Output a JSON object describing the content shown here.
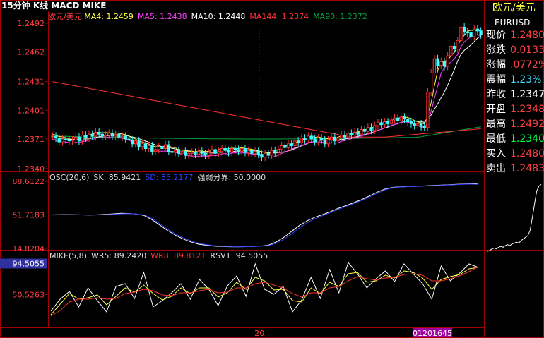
{
  "window_title": "15分钟 K线 MACD MIKE",
  "instrument": {
    "name": "欧元/美元",
    "code": "EURUSD"
  },
  "quote": [
    {
      "label": "现价",
      "value": "1.2480",
      "color": "#ff4040"
    },
    {
      "label": "涨跌",
      "value": "0.0133",
      "color": "#ff4040"
    },
    {
      "label": "涨幅",
      "value": ".0772%",
      "color": "#ff4040"
    },
    {
      "label": "震幅",
      "value": "1.23%",
      "color": "#40e0ff"
    },
    {
      "label": "昨收",
      "value": "1.2347",
      "color": "#ffffff"
    },
    {
      "label": "开盘",
      "value": "1.2348",
      "color": "#ff4040"
    },
    {
      "label": "最高",
      "value": "1.2492",
      "color": "#ff4040"
    },
    {
      "label": "最低",
      "value": "1.2340",
      "color": "#00ff40"
    },
    {
      "label": "买入",
      "value": "1.2480",
      "color": "#ff4040"
    },
    {
      "label": "卖出",
      "value": "1.2483",
      "color": "#ff4040"
    }
  ],
  "colors": {
    "bg": "#000000",
    "frame": "#a00000",
    "up": "#ff3030",
    "down": "#40ffff",
    "yellow": "#ffff40",
    "white": "#ffffff",
    "magenta": "#ff40ff",
    "red": "#ff3030",
    "green": "#00a040",
    "blue": "#3040ff",
    "axis_text": "#ff4040"
  },
  "chart_data": [
    {
      "type": "candlestick",
      "legend": {
        "symbol": "欧元/美元",
        "items": [
          {
            "name": "MA4",
            "value": "1.2459",
            "color": "#ffff40"
          },
          {
            "name": "MA5",
            "value": "1.2438",
            "color": "#ff40ff"
          },
          {
            "name": "MA10",
            "value": "1.2448",
            "color": "#ffffff"
          },
          {
            "name": "MA144",
            "value": "1.2374",
            "color": "#ff3030"
          },
          {
            "name": "MA90",
            "value": "1.2372",
            "color": "#00a040"
          }
        ]
      },
      "yticks": [
        "1.2492",
        "1.2462",
        "1.2431",
        "1.2401",
        "1.2371",
        "1.2340"
      ],
      "ylim": [
        1.234,
        1.2492
      ],
      "xticks": [
        "20"
      ],
      "ohlc_close": [
        1.2374,
        1.2372,
        1.2368,
        1.2371,
        1.237,
        1.2369,
        1.237,
        1.2373,
        1.2369,
        1.2375,
        1.2372,
        1.2376,
        1.2374,
        1.2378,
        1.2376,
        1.2374,
        1.2375,
        1.2377,
        1.2374,
        1.2376,
        1.2373,
        1.2374,
        1.2371,
        1.237,
        1.2366,
        1.2369,
        1.2363,
        1.2366,
        1.2361,
        1.2364,
        1.2358,
        1.236,
        1.2363,
        1.2361,
        1.2365,
        1.2358,
        1.2357,
        1.2359,
        1.2356,
        1.2358,
        1.2354,
        1.2356,
        1.2357,
        1.2355,
        1.2358,
        1.2356,
        1.2354,
        1.2357,
        1.236,
        1.2356,
        1.2358,
        1.2361,
        1.2359,
        1.2357,
        1.2361,
        1.236,
        1.2358,
        1.2361,
        1.2357,
        1.2359,
        1.2356,
        1.2358,
        1.2355,
        1.2352,
        1.2356,
        1.2354,
        1.2359,
        1.2357,
        1.236,
        1.2364,
        1.2362,
        1.2366,
        1.2364,
        1.2369,
        1.2367,
        1.2372,
        1.237,
        1.2374,
        1.2371,
        1.2368,
        1.2372,
        1.237,
        1.2366,
        1.237,
        1.2373,
        1.2369,
        1.2372,
        1.2375,
        1.2373,
        1.2377,
        1.2375,
        1.2378,
        1.2376,
        1.2381,
        1.2379,
        1.2383,
        1.238,
        1.2385,
        1.2388,
        1.2386,
        1.2389,
        1.2387,
        1.2391,
        1.2393,
        1.239,
        1.2394,
        1.2392,
        1.2389,
        1.2387,
        1.2385,
        1.2387,
        1.2384,
        1.2383,
        1.242,
        1.244,
        1.2455,
        1.2448,
        1.2452,
        1.2447,
        1.2458,
        1.2468,
        1.2465,
        1.2474,
        1.2488,
        1.2483,
        1.2482,
        1.2478,
        1.2486,
        1.2484,
        1.248
      ]
    },
    {
      "type": "line",
      "legend": {
        "items": [
          {
            "name": "OSC(20,6)",
            "value": "",
            "color": "#dddddd"
          },
          {
            "name": "SK",
            "value": "85.9421",
            "color": "#dddddd"
          },
          {
            "name": "SD",
            "value": "85.2177",
            "color": "#3040ff"
          },
          {
            "name": "强弱分界",
            "value": "50.0000",
            "color": "#dddddd"
          }
        ]
      },
      "yticks": [
        "88.6122",
        "51.7183",
        "14.8204"
      ],
      "ylim": [
        14.8204,
        88.6122
      ],
      "divider": 51.7183,
      "series": [
        {
          "name": "SK",
          "values": [
            51.7,
            51.9,
            52.0,
            51.9,
            51.7,
            51.5,
            51.8,
            52.3,
            52.8,
            53.4,
            53.3,
            52.6,
            51.0,
            46.4,
            40.5,
            34.6,
            29.5,
            25.2,
            22.0,
            19.5,
            18.3,
            17.4,
            16.9,
            16.7,
            16.6,
            16.8,
            17.0,
            17.4,
            18.4,
            21.9,
            27.2,
            33.7,
            40.2,
            45.3,
            49.2,
            52.1,
            55.4,
            59.0,
            62.0,
            65.2,
            68.6,
            72.6,
            76.7,
            80.2,
            82.0,
            82.6,
            82.9,
            83.1,
            83.6,
            84.0,
            84.4,
            84.7,
            85.2,
            85.6,
            85.9,
            86.2
          ]
        },
        {
          "name": "SD",
          "values": [
            51.5,
            51.7,
            51.8,
            51.8,
            51.7,
            51.6,
            51.6,
            51.9,
            52.3,
            52.8,
            53.0,
            52.7,
            51.6,
            47.8,
            42.1,
            36.0,
            30.9,
            26.6,
            23.2,
            20.6,
            19.0,
            17.9,
            17.2,
            16.9,
            16.7,
            16.7,
            16.9,
            17.2,
            17.9,
            20.3,
            24.9,
            31.0,
            37.5,
            43.1,
            47.6,
            51.0,
            54.3,
            57.9,
            61.0,
            64.2,
            67.6,
            71.4,
            75.6,
            79.3,
            81.6,
            82.4,
            82.8,
            83.0,
            83.4,
            83.8,
            84.2,
            84.5,
            84.9,
            85.3,
            85.6,
            85.2
          ]
        }
      ]
    },
    {
      "type": "line",
      "legend": {
        "items": [
          {
            "name": "MIKE(5,8)",
            "value": "",
            "color": "#dddddd"
          },
          {
            "name": "WR5",
            "value": "89.2420",
            "color": "#dddddd"
          },
          {
            "name": "WR8",
            "value": "89.8121",
            "color": "#ff3030"
          },
          {
            "name": "RSV1",
            "value": "94.5055",
            "color": "#dddddd"
          }
        ]
      },
      "yticks": [
        "94.5055",
        "50.5263"
      ],
      "ylim": [
        6,
        100
      ],
      "xticks": [
        "20",
        "01201645"
      ],
      "series": [
        {
          "name": "RSV1",
          "values": [
            27,
            44,
            55,
            33,
            60,
            42,
            26,
            62,
            66,
            45,
            82,
            33,
            42,
            53,
            66,
            44,
            72,
            58,
            35,
            63,
            77,
            48,
            94,
            58,
            51,
            62,
            26,
            43,
            75,
            45,
            86,
            53,
            96,
            80,
            60,
            73,
            84,
            69,
            94,
            80,
            66,
            44,
            91,
            70,
            81,
            94,
            89
          ]
        },
        {
          "name": "WR5",
          "values": [
            22,
            37,
            52,
            44,
            46,
            50,
            36,
            48,
            60,
            54,
            64,
            52,
            43,
            48,
            60,
            52,
            60,
            60,
            47,
            53,
            68,
            58,
            75,
            70,
            57,
            58,
            42,
            40,
            60,
            52,
            68,
            62,
            80,
            82,
            68,
            70,
            78,
            74,
            84,
            82,
            74,
            58,
            72,
            76,
            79,
            87,
            89
          ]
        },
        {
          "name": "WR8",
          "values": [
            20,
            28,
            40,
            44,
            44,
            46,
            44,
            45,
            52,
            54,
            58,
            56,
            50,
            49,
            53,
            53,
            56,
            58,
            53,
            54,
            60,
            60,
            66,
            68,
            64,
            60,
            52,
            47,
            53,
            53,
            60,
            62,
            70,
            76,
            73,
            71,
            74,
            75,
            79,
            80,
            78,
            70,
            70,
            73,
            77,
            83,
            90
          ]
        }
      ]
    },
    {
      "type": "line",
      "series": [
        {
          "name": "mini",
          "values": [
            5,
            6,
            8,
            9,
            8,
            10,
            11,
            10,
            12,
            13,
            12,
            14,
            15,
            16,
            15,
            18,
            20,
            22,
            24,
            30,
            45,
            62,
            78,
            84,
            86
          ]
        }
      ]
    }
  ]
}
